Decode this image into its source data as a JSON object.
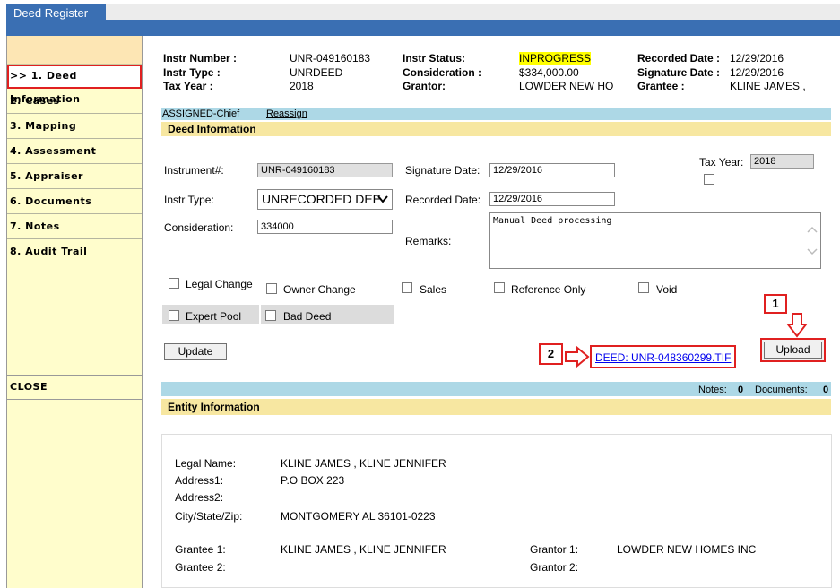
{
  "tab": {
    "title": "Deed Register"
  },
  "sidebar": {
    "items": [
      {
        "label": ">> 1. Deed Information"
      },
      {
        "label": "2. Cases"
      },
      {
        "label": "3. Mapping"
      },
      {
        "label": "4. Assessment"
      },
      {
        "label": "5. Appraiser"
      },
      {
        "label": "6. Documents"
      },
      {
        "label": "7. Notes"
      },
      {
        "label": "8. Audit Trail"
      }
    ],
    "close_label": "CLOSE"
  },
  "header": {
    "instr_number_label": "Instr Number :",
    "instr_number": "UNR-049160183",
    "instr_type_label": "Instr Type :",
    "instr_type": "UNRDEED",
    "tax_year_label": "Tax Year :",
    "tax_year": "2018",
    "instr_status_label": "Instr Status:",
    "instr_status": "INPROGRESS",
    "consideration_label": "Consideration :",
    "consideration": "$334,000.00",
    "grantor_label": "Grantor:",
    "grantor": "LOWDER NEW HO",
    "recorded_date_label": "Recorded Date :",
    "recorded_date": "12/29/2016",
    "signature_date_label": "Signature Date :",
    "signature_date": "12/29/2016",
    "grantee_label": "Grantee :",
    "grantee": "KLINE JAMES ,"
  },
  "assign": {
    "assigned": "ASSIGNED-Chief",
    "reassign_link": "Reassign"
  },
  "deed": {
    "section_title": "Deed Information",
    "instrument_label": "Instrument#:",
    "instrument_value": "UNR-049160183",
    "instr_type_label": "Instr Type:",
    "instr_type_value": "UNRECORDED DEE",
    "consideration_label": "Consideration:",
    "consideration_value": "334000",
    "signature_date_label": "Signature Date:",
    "signature_date_value": "12/29/2016",
    "recorded_date_label": "Recorded Date:",
    "recorded_date_value": "12/29/2016",
    "remarks_label": "Remarks:",
    "remarks_value": "Manual Deed processing",
    "tax_year_label": "Tax Year:",
    "tax_year_value": "2018",
    "checkboxes": {
      "legal_change": "Legal Change",
      "owner_change": "Owner Change",
      "sales": "Sales",
      "reference_only": "Reference Only",
      "void": "Void",
      "expert_pool": "Expert Pool",
      "bad_deed": "Bad Deed"
    },
    "update_button": "Update",
    "upload_button": "Upload",
    "file_link": "DEED: UNR-048360299.TIF",
    "callout_1": "1",
    "callout_2": "2"
  },
  "notes_bar": {
    "notes_label": "Notes:",
    "notes_count": "0",
    "documents_label": "Documents:",
    "documents_count": "0"
  },
  "entity": {
    "section_title": "Entity Information",
    "legal_name_label": "Legal Name:",
    "legal_name": "KLINE JAMES , KLINE JENNIFER",
    "address1_label": "Address1:",
    "address1": "P.O BOX 223",
    "address2_label": "Address2:",
    "address2": "",
    "city_label": "City/State/Zip:",
    "city": "MONTGOMERY AL 36101-0223",
    "grantee1_label": "Grantee 1:",
    "grantee1": "KLINE JAMES , KLINE JENNIFER",
    "grantee2_label": "Grantee 2:",
    "grantee2": "",
    "grantor1_label": "Grantor 1:",
    "grantor1": "LOWDER NEW HOMES INC",
    "grantor2_label": "Grantor 2:",
    "grantor2": ""
  },
  "colors": {
    "brand_blue": "#3a6fb3",
    "section_yellow": "#f7e7a1",
    "bar_lightblue": "#add8e6",
    "highlight_red": "#e02020",
    "status_yellow": "#ffff00"
  }
}
